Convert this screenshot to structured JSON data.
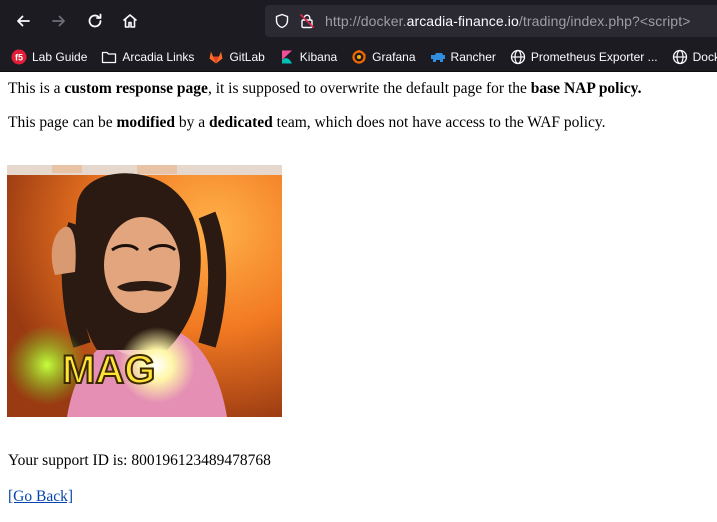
{
  "browser": {
    "url_prefix": "http://docker.",
    "url_host": "arcadia-finance.io",
    "url_path": "/trading/index.php?<script>"
  },
  "bookmarks": [
    {
      "label": "Lab Guide",
      "icon": "f5-icon"
    },
    {
      "label": "Arcadia Links",
      "icon": "folder-icon"
    },
    {
      "label": "GitLab",
      "icon": "gitlab-icon"
    },
    {
      "label": "Kibana",
      "icon": "kibana-icon"
    },
    {
      "label": "Grafana",
      "icon": "grafana-icon"
    },
    {
      "label": "Rancher",
      "icon": "rancher-icon"
    },
    {
      "label": "Prometheus Exporter ...",
      "icon": "globe-icon"
    },
    {
      "label": "Docker Reg",
      "icon": "globe-icon"
    }
  ],
  "page": {
    "p1": {
      "t1": "This is a ",
      "b1": "custom response page",
      "t2": ", it is supposed to overwrite the default page for the ",
      "b2": "base NAP policy."
    },
    "p2": {
      "t1": "This page can be ",
      "b1": "modified",
      "t2": " by a ",
      "b2": "dedicated",
      "t3": " team, which does not have access to the WAF policy."
    },
    "gif_caption": "MAG",
    "support_label": "Your support ID is: ",
    "support_id": "800196123489478768",
    "go_back": "[Go Back]"
  },
  "colors": {
    "chrome_bg": "#1c1b22",
    "urlbar_bg": "#2b2a33",
    "link": "#0645ad"
  }
}
